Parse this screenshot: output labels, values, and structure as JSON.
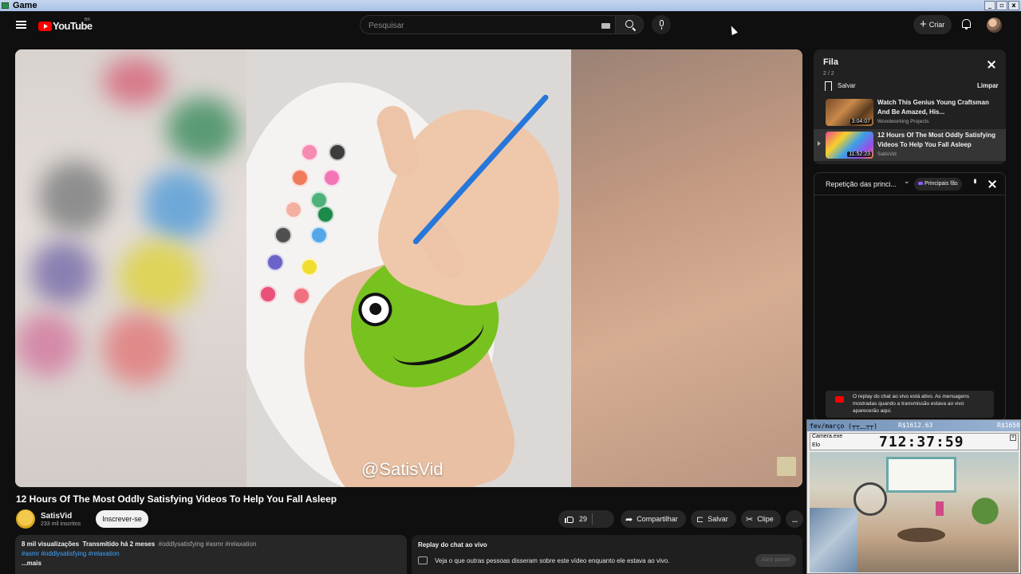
{
  "os": {
    "app_title": "Game",
    "buttons": [
      "_",
      "▫",
      "x"
    ]
  },
  "masthead": {
    "logo_text": "YouTube",
    "country_code": "BR",
    "search_placeholder": "Pesquisar",
    "create_label": "Criar"
  },
  "player": {
    "watermark": "@SatisVid"
  },
  "video": {
    "title": "12 Hours Of The Most Oddly Satisfying Videos To Help You Fall Asleep",
    "channel": "SatisVid",
    "subscribers": "233 mil inscritos",
    "subscribe_label": "Inscrever-se",
    "likes": "29",
    "share_label": "Compartilhar",
    "save_label": "Salvar",
    "clip_label": "Clipe",
    "more_label": "..."
  },
  "description": {
    "views": "8 mil visualizações",
    "streamed": "Transmitido há 2 meses",
    "tags": "#oddlysatisfying #asmr #relaxation",
    "hashtags": "#asmr #oddlysatisfying #relaxation",
    "more": "...mais"
  },
  "chat_replay_box": {
    "title": "Replay do chat ao vivo",
    "text": "Veja o que outras pessoas disseram sobre este vídeo enquanto ele estava ao vivo.",
    "open_label": "Abrir painel"
  },
  "queue": {
    "title": "Fila",
    "count": "2 / 2",
    "save_label": "Salvar",
    "clear_label": "Limpar",
    "items": [
      {
        "title": "Watch This Genius Young Craftsman And Be Amazed, His...",
        "channel": "Woodworking Projects",
        "duration": "3:04:07"
      },
      {
        "title": "12 Hours Of The Most Oddly Satisfying Videos To Help You Fall Asleep",
        "channel": "SatisVid",
        "duration": "11:52:23"
      }
    ]
  },
  "chat_panel": {
    "mode": "Repetição das princi...",
    "top_fans": "Principais fãs",
    "notice": "O replay do chat ao vivo está ativo. As mensagens mostradas quando a transmissão estava ao vivo aparecerão aqui."
  },
  "overlay": {
    "left_text": "fev/março (┬┬﹏┬┬)",
    "mid_text": "R$1612.63",
    "right_text": "R$1650",
    "window_title": "Camera.exe",
    "window_sub": "Elo",
    "timer": "712:37:59"
  }
}
